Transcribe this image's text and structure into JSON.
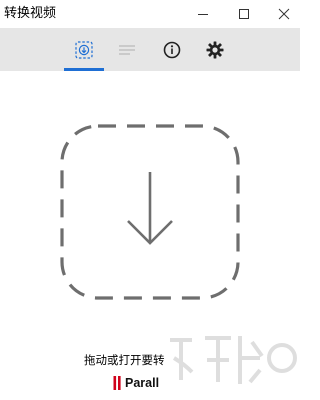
{
  "window": {
    "title": "转换视频",
    "controls": [
      "minimize-icon",
      "maximize-icon",
      "close-icon"
    ]
  },
  "toolbar": {
    "tabs": [
      {
        "icon": "download-icon",
        "active": true
      },
      {
        "icon": "list-icon",
        "active": false
      },
      {
        "icon": "info-icon",
        "active": false
      },
      {
        "icon": "gear-icon",
        "active": false
      }
    ],
    "active_color": "#1f6fd4"
  },
  "dropzone": {
    "icon": "download-arrow-icon",
    "hint": "拖动或打开要转"
  },
  "brand": {
    "text": "Parall",
    "accent": "#d0021b"
  },
  "watermark": {
    "icon": "watermark-logo"
  }
}
